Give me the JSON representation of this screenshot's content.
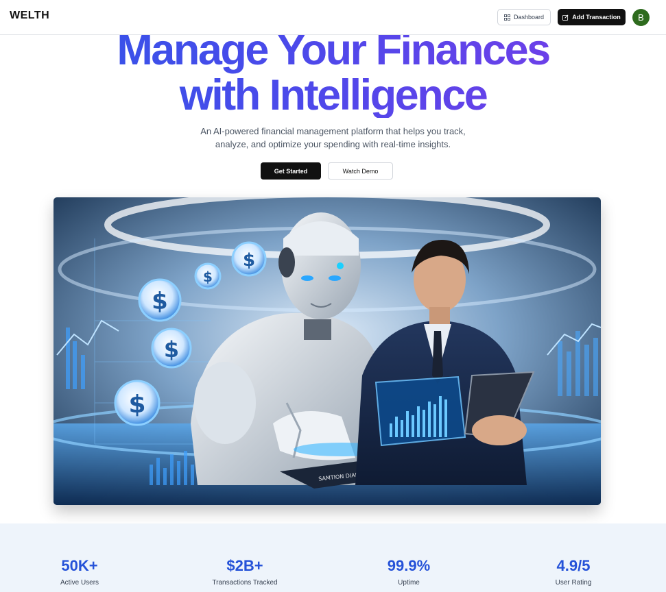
{
  "header": {
    "logo": "WELTH",
    "dashboard_label": "Dashboard",
    "add_transaction_label": "Add Transaction",
    "avatar_initial": "B"
  },
  "hero": {
    "title_line1": "Manage Your Finances",
    "title_line2": "with Intelligence",
    "subtitle_line1": "An AI-powered financial management platform that helps you track,",
    "subtitle_line2": "analyze, and optimize your spending with real-time insights.",
    "get_started_label": "Get Started",
    "watch_demo_label": "Watch Demo",
    "image_icon": "ai-robot-and-businessman-finance-illustration",
    "image_tablet_text": "SAMTION DIAMOLDS SOTH"
  },
  "stats": [
    {
      "value": "50K+",
      "label": "Active Users"
    },
    {
      "value": "$2B+",
      "label": "Transactions Tracked"
    },
    {
      "value": "99.9%",
      "label": "Uptime"
    },
    {
      "value": "4.9/5",
      "label": "User Rating"
    }
  ],
  "colors": {
    "accent": "#2552d8",
    "gradient_start": "#2f56e8",
    "gradient_end": "#7a3ce8",
    "avatar_bg": "#2e6b1e",
    "stats_bg": "#eef4fb"
  }
}
